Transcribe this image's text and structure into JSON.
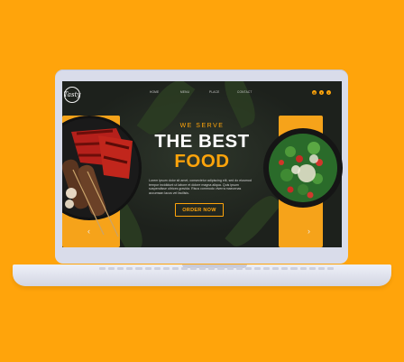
{
  "colors": {
    "background": "#FFA40B",
    "accent": "#FFA40B",
    "screen_bg": "#1d211c"
  },
  "site": {
    "logo_text": "Tasty",
    "nav": [
      "HOME",
      "MENU",
      "PLACE",
      "CONTACT"
    ],
    "social": [
      "instagram-icon",
      "facebook-icon",
      "twitter-icon"
    ]
  },
  "hero": {
    "eyebrow": "WE SERVE",
    "title_line1": "THE BEST",
    "title_line2": "FOOD",
    "description": "Lorem ipsum dolor sit amet, consectetur adipiscing elit, sed do eiusmod tempor incididunt ut labore et dolore magna aliqua. Quis ipsum suspendisse ultrices gravida. Risus commodo viverra maecenas accumsan lacus vel facilisis.",
    "cta": "ORDER NOW"
  },
  "slider": {
    "prev_icon": "chevron-left-icon",
    "next_icon": "chevron-right-icon"
  }
}
